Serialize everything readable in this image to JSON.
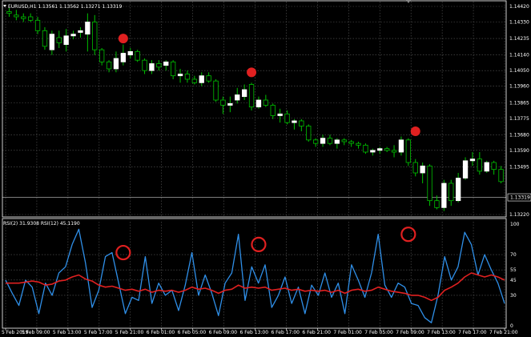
{
  "main_title": "EURUSD,H1  1.13561 1.13562 1.13271 1.13319",
  "rsi_title": "RSI(2) 31.9308  RSI(12) 45.1190",
  "current_price_label": "1.13319",
  "colors": {
    "background": "#000000",
    "grid": "#5a5a5a",
    "bull_candle": "#ffffff",
    "bear_candle": "#000000",
    "wick": "#00c000",
    "rsi_fast": "#2f8fe8",
    "rsi_slow": "#e02020",
    "marker": "#e02020",
    "text": "#ffffff"
  },
  "chart_data": [
    {
      "type": "candlestick",
      "title": "EURUSD,H1  1.13561 1.13562 1.13271 1.13319",
      "y_ticks": [
        1.1442,
        1.1433,
        1.14235,
        1.1414,
        1.1405,
        1.1396,
        1.13865,
        1.13775,
        1.1368,
        1.1359,
        1.13495,
        1.13319,
        1.1322
      ],
      "ylim": [
        1.1322,
        1.1442
      ],
      "last_price": 1.13319,
      "candles": [
        {
          "o": 1.1439,
          "h": 1.1441,
          "l": 1.1436,
          "c": 1.1438
        },
        {
          "o": 1.1437,
          "h": 1.144,
          "l": 1.1434,
          "c": 1.1436
        },
        {
          "o": 1.1436,
          "h": 1.1438,
          "l": 1.1433,
          "c": 1.1435
        },
        {
          "o": 1.1436,
          "h": 1.1438,
          "l": 1.1433,
          "c": 1.1434
        },
        {
          "o": 1.1434,
          "h": 1.1436,
          "l": 1.1426,
          "c": 1.1428
        },
        {
          "o": 1.1428,
          "h": 1.143,
          "l": 1.1417,
          "c": 1.1419
        },
        {
          "o": 1.1417,
          "h": 1.1428,
          "l": 1.1414,
          "c": 1.1426
        },
        {
          "o": 1.1424,
          "h": 1.1428,
          "l": 1.1418,
          "c": 1.1421
        },
        {
          "o": 1.142,
          "h": 1.1429,
          "l": 1.1416,
          "c": 1.1425
        },
        {
          "o": 1.1425,
          "h": 1.1428,
          "l": 1.1423,
          "c": 1.1426
        },
        {
          "o": 1.1427,
          "h": 1.143,
          "l": 1.1424,
          "c": 1.1428
        },
        {
          "o": 1.1426,
          "h": 1.1438,
          "l": 1.1416,
          "c": 1.1433
        },
        {
          "o": 1.1433,
          "h": 1.1437,
          "l": 1.1414,
          "c": 1.1417
        },
        {
          "o": 1.1417,
          "h": 1.1418,
          "l": 1.1408,
          "c": 1.141
        },
        {
          "o": 1.141,
          "h": 1.1411,
          "l": 1.1404,
          "c": 1.1406
        },
        {
          "o": 1.1406,
          "h": 1.1416,
          "l": 1.1404,
          "c": 1.1412
        },
        {
          "o": 1.141,
          "h": 1.142,
          "l": 1.1408,
          "c": 1.1415
        },
        {
          "o": 1.1414,
          "h": 1.1418,
          "l": 1.1412,
          "c": 1.1416
        },
        {
          "o": 1.1416,
          "h": 1.1417,
          "l": 1.141,
          "c": 1.1411
        },
        {
          "o": 1.1411,
          "h": 1.1412,
          "l": 1.1403,
          "c": 1.1405
        },
        {
          "o": 1.1405,
          "h": 1.1411,
          "l": 1.1403,
          "c": 1.1409
        },
        {
          "o": 1.1409,
          "h": 1.1411,
          "l": 1.1405,
          "c": 1.1407
        },
        {
          "o": 1.1408,
          "h": 1.1411,
          "l": 1.1405,
          "c": 1.141
        },
        {
          "o": 1.141,
          "h": 1.1411,
          "l": 1.14,
          "c": 1.1402
        },
        {
          "o": 1.1402,
          "h": 1.1406,
          "l": 1.1398,
          "c": 1.1403
        },
        {
          "o": 1.1403,
          "h": 1.1405,
          "l": 1.1398,
          "c": 1.14
        },
        {
          "o": 1.14,
          "h": 1.1402,
          "l": 1.1397,
          "c": 1.1398
        },
        {
          "o": 1.1398,
          "h": 1.1404,
          "l": 1.1396,
          "c": 1.1402
        },
        {
          "o": 1.1402,
          "h": 1.1404,
          "l": 1.1398,
          "c": 1.1399
        },
        {
          "o": 1.1399,
          "h": 1.14,
          "l": 1.1387,
          "c": 1.1388
        },
        {
          "o": 1.1388,
          "h": 1.139,
          "l": 1.138,
          "c": 1.1385
        },
        {
          "o": 1.1385,
          "h": 1.139,
          "l": 1.1381,
          "c": 1.1386
        },
        {
          "o": 1.1388,
          "h": 1.1395,
          "l": 1.1386,
          "c": 1.1391
        },
        {
          "o": 1.139,
          "h": 1.1397,
          "l": 1.1388,
          "c": 1.1394
        },
        {
          "o": 1.1397,
          "h": 1.1398,
          "l": 1.1382,
          "c": 1.1384
        },
        {
          "o": 1.1384,
          "h": 1.139,
          "l": 1.1383,
          "c": 1.1388
        },
        {
          "o": 1.1388,
          "h": 1.1391,
          "l": 1.1384,
          "c": 1.1385
        },
        {
          "o": 1.1385,
          "h": 1.1386,
          "l": 1.1377,
          "c": 1.1379
        },
        {
          "o": 1.1379,
          "h": 1.1383,
          "l": 1.1375,
          "c": 1.138
        },
        {
          "o": 1.138,
          "h": 1.1382,
          "l": 1.1374,
          "c": 1.1375
        },
        {
          "o": 1.1375,
          "h": 1.1377,
          "l": 1.1371,
          "c": 1.1376
        },
        {
          "o": 1.1376,
          "h": 1.1377,
          "l": 1.137,
          "c": 1.1373
        },
        {
          "o": 1.1373,
          "h": 1.1374,
          "l": 1.1364,
          "c": 1.1365
        },
        {
          "o": 1.1365,
          "h": 1.1366,
          "l": 1.1361,
          "c": 1.1363
        },
        {
          "o": 1.1363,
          "h": 1.1368,
          "l": 1.1361,
          "c": 1.1366
        },
        {
          "o": 1.1366,
          "h": 1.1368,
          "l": 1.1362,
          "c": 1.1363
        },
        {
          "o": 1.1363,
          "h": 1.1366,
          "l": 1.136,
          "c": 1.1365
        },
        {
          "o": 1.1365,
          "h": 1.1366,
          "l": 1.1362,
          "c": 1.1364
        },
        {
          "o": 1.1364,
          "h": 1.1365,
          "l": 1.1361,
          "c": 1.1363
        },
        {
          "o": 1.1363,
          "h": 1.1364,
          "l": 1.136,
          "c": 1.1362
        },
        {
          "o": 1.1362,
          "h": 1.1363,
          "l": 1.1357,
          "c": 1.1358
        },
        {
          "o": 1.1358,
          "h": 1.136,
          "l": 1.1356,
          "c": 1.1359
        },
        {
          "o": 1.1359,
          "h": 1.1361,
          "l": 1.1357,
          "c": 1.136
        },
        {
          "o": 1.136,
          "h": 1.1361,
          "l": 1.1358,
          "c": 1.1359
        },
        {
          "o": 1.1359,
          "h": 1.1362,
          "l": 1.1355,
          "c": 1.1358
        },
        {
          "o": 1.1358,
          "h": 1.1367,
          "l": 1.1356,
          "c": 1.1365
        },
        {
          "o": 1.1365,
          "h": 1.1366,
          "l": 1.135,
          "c": 1.1352
        },
        {
          "o": 1.1352,
          "h": 1.1354,
          "l": 1.1344,
          "c": 1.1346
        },
        {
          "o": 1.1346,
          "h": 1.1352,
          "l": 1.134,
          "c": 1.135
        },
        {
          "o": 1.135,
          "h": 1.1351,
          "l": 1.1327,
          "c": 1.133
        },
        {
          "o": 1.133,
          "h": 1.1333,
          "l": 1.1325,
          "c": 1.1326
        },
        {
          "o": 1.1326,
          "h": 1.1342,
          "l": 1.1324,
          "c": 1.134
        },
        {
          "o": 1.134,
          "h": 1.1342,
          "l": 1.1327,
          "c": 1.133
        },
        {
          "o": 1.133,
          "h": 1.1346,
          "l": 1.1329,
          "c": 1.1343
        },
        {
          "o": 1.1343,
          "h": 1.1355,
          "l": 1.1342,
          "c": 1.1353
        },
        {
          "o": 1.1353,
          "h": 1.1358,
          "l": 1.135,
          "c": 1.1354
        },
        {
          "o": 1.1354,
          "h": 1.1358,
          "l": 1.1345,
          "c": 1.1347
        },
        {
          "o": 1.1347,
          "h": 1.1353,
          "l": 1.1346,
          "c": 1.1352
        },
        {
          "o": 1.1352,
          "h": 1.1353,
          "l": 1.1345,
          "c": 1.1348
        },
        {
          "o": 1.1348,
          "h": 1.135,
          "l": 1.134,
          "c": 1.1341
        }
      ],
      "markers": [
        {
          "index": 16,
          "price": 1.14235
        },
        {
          "index": 34,
          "price": 1.1404
        },
        {
          "index": 57,
          "price": 1.137
        }
      ]
    },
    {
      "type": "line",
      "title": "RSI(2) 31.9308  RSI(12) 45.1190",
      "y_ticks": [
        100,
        70,
        55,
        45,
        30,
        0
      ],
      "ylim": [
        0,
        100
      ],
      "x_tick_labels": [
        "5 Feb 2019",
        "5 Feb 09:00",
        "5 Feb 13:00",
        "5 Feb 17:00",
        "5 Feb 21:00",
        "6 Feb 01:00",
        "6 Feb 05:00",
        "6 Feb 09:00",
        "6 Feb 13:00",
        "6 Feb 17:00",
        "6 Feb 21:00",
        "7 Feb 01:00",
        "7 Feb 05:00",
        "7 Feb 09:00",
        "7 Feb 13:00",
        "7 Feb 17:00",
        "7 Feb 21:00"
      ],
      "series": [
        {
          "name": "RSI(2)",
          "values": [
            45,
            32,
            20,
            45,
            38,
            12,
            42,
            30,
            52,
            58,
            80,
            95,
            62,
            18,
            35,
            68,
            72,
            42,
            12,
            28,
            25,
            68,
            22,
            42,
            30,
            35,
            15,
            40,
            72,
            30,
            50,
            32,
            10,
            42,
            52,
            90,
            25,
            58,
            42,
            60,
            18,
            30,
            48,
            22,
            38,
            12,
            40,
            30,
            52,
            28,
            42,
            12,
            60,
            45,
            28,
            52,
            90,
            40,
            28,
            42,
            38,
            22,
            20,
            8,
            3,
            30,
            68,
            45,
            58,
            92,
            80,
            50,
            70,
            55,
            42,
            22
          ]
        },
        {
          "name": "RSI(12)",
          "values": [
            42,
            42,
            42,
            43,
            44,
            43,
            40,
            41,
            44,
            45,
            48,
            50,
            46,
            44,
            40,
            38,
            39,
            37,
            35,
            36,
            34,
            36,
            33,
            35,
            34,
            35,
            33,
            35,
            38,
            36,
            37,
            35,
            32,
            35,
            36,
            40,
            37,
            38,
            37,
            38,
            35,
            36,
            37,
            35,
            36,
            34,
            35,
            34,
            35,
            33,
            35,
            32,
            35,
            36,
            34,
            35,
            38,
            36,
            34,
            33,
            32,
            30,
            30,
            28,
            25,
            28,
            35,
            38,
            42,
            48,
            52,
            50,
            48,
            50,
            48,
            45
          ]
        }
      ],
      "markers": [
        {
          "index": 16,
          "value": 72
        },
        {
          "index": 35,
          "value": 80
        },
        {
          "index": 56,
          "value": 90
        }
      ]
    }
  ]
}
